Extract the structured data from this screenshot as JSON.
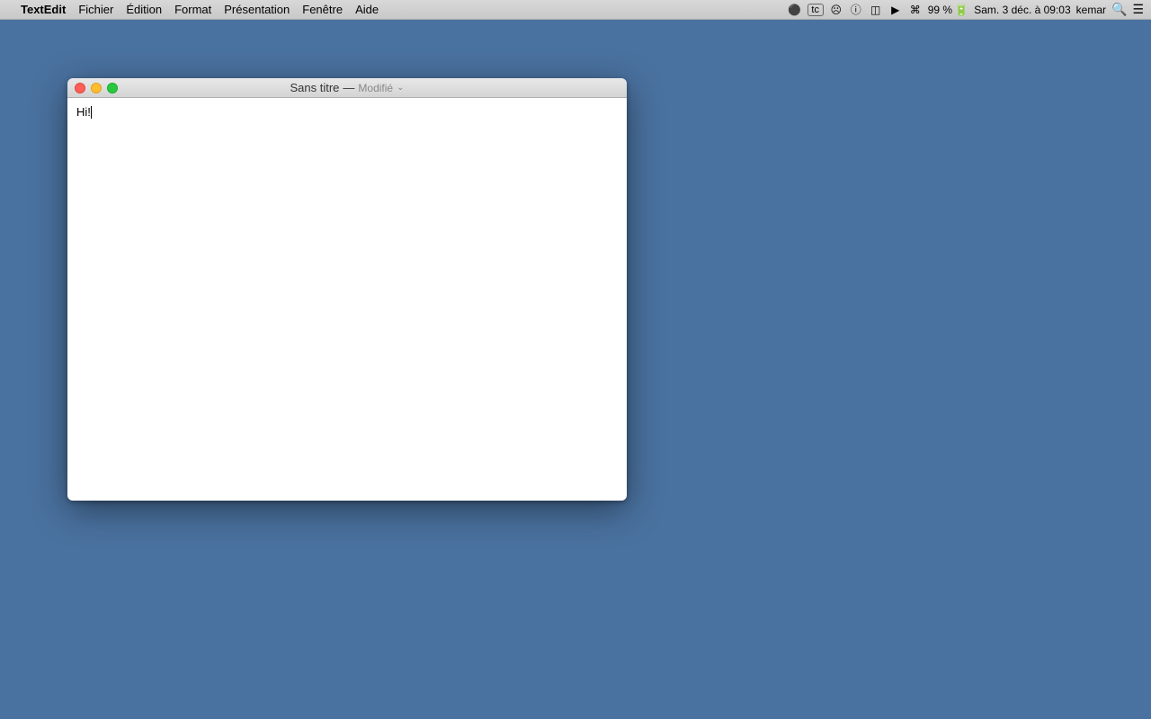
{
  "menubar": {
    "apple_symbol": "",
    "items": [
      {
        "id": "textedit",
        "label": "TextEdit",
        "bold": true
      },
      {
        "id": "fichier",
        "label": "Fichier",
        "bold": false
      },
      {
        "id": "edition",
        "label": "Édition",
        "bold": false
      },
      {
        "id": "format",
        "label": "Format",
        "bold": false
      },
      {
        "id": "presentation",
        "label": "Présentation",
        "bold": false
      },
      {
        "id": "fenetre",
        "label": "Fenêtre",
        "bold": false
      },
      {
        "id": "aide",
        "label": "Aide",
        "bold": false
      }
    ],
    "status": {
      "battery_percent": "99 %",
      "datetime": "Sam. 3 déc. à  09:03",
      "username": "kemar"
    }
  },
  "window": {
    "title": "Sans titre",
    "separator": "—",
    "modified_label": "Modifié",
    "content": "Hi!",
    "buttons": {
      "close": "close",
      "minimize": "minimize",
      "maximize": "maximize"
    }
  }
}
